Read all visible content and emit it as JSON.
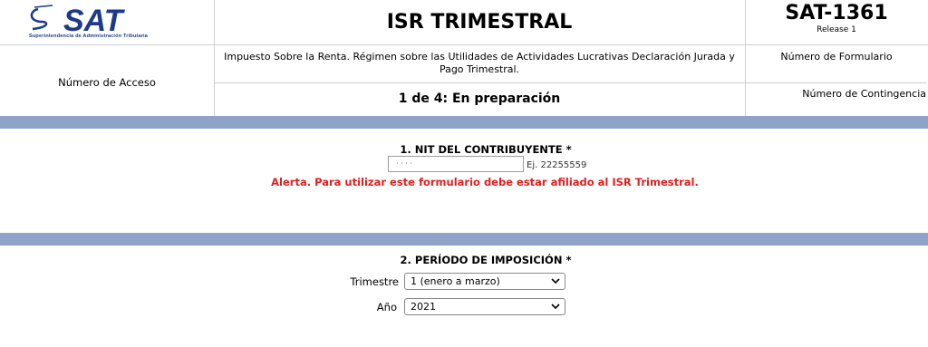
{
  "header": {
    "logo_text": "SAT",
    "logo_subtitle": "Superintendencia de Administración Tributaria",
    "title": "ISR TRIMESTRAL",
    "form_code": "SAT-1361",
    "release": "Release 1",
    "access_label": "Número de Acceso",
    "description": "Impuesto Sobre la Renta. Régimen sobre las Utilidades de Actividades Lucrativas Declaración Jurada y Pago Trimestral.",
    "form_number_label": "Número de Formulario",
    "status": "1 de 4: En preparación",
    "contingency_label": "Número de Contingencia"
  },
  "section_nit": {
    "title": "1. NIT DEL CONTRIBUYENTE *",
    "input_value": "· · · ·",
    "example": "Ej. 22255559",
    "alert": "Alerta. Para utilizar este formulario debe estar afiliado al ISR Trimestral."
  },
  "section_period": {
    "title": "2. PERÍODO DE IMPOSICIÓN *",
    "quarter_label": "Trimestre",
    "quarter_value": "1 (enero a marzo)",
    "year_label": "Año",
    "year_value": "2021"
  },
  "colors": {
    "band": "#8fa2c8",
    "alert": "#e02020",
    "logo": "#1d3a8a"
  },
  "icons": {
    "dropdown": "chevron-down-icon"
  }
}
